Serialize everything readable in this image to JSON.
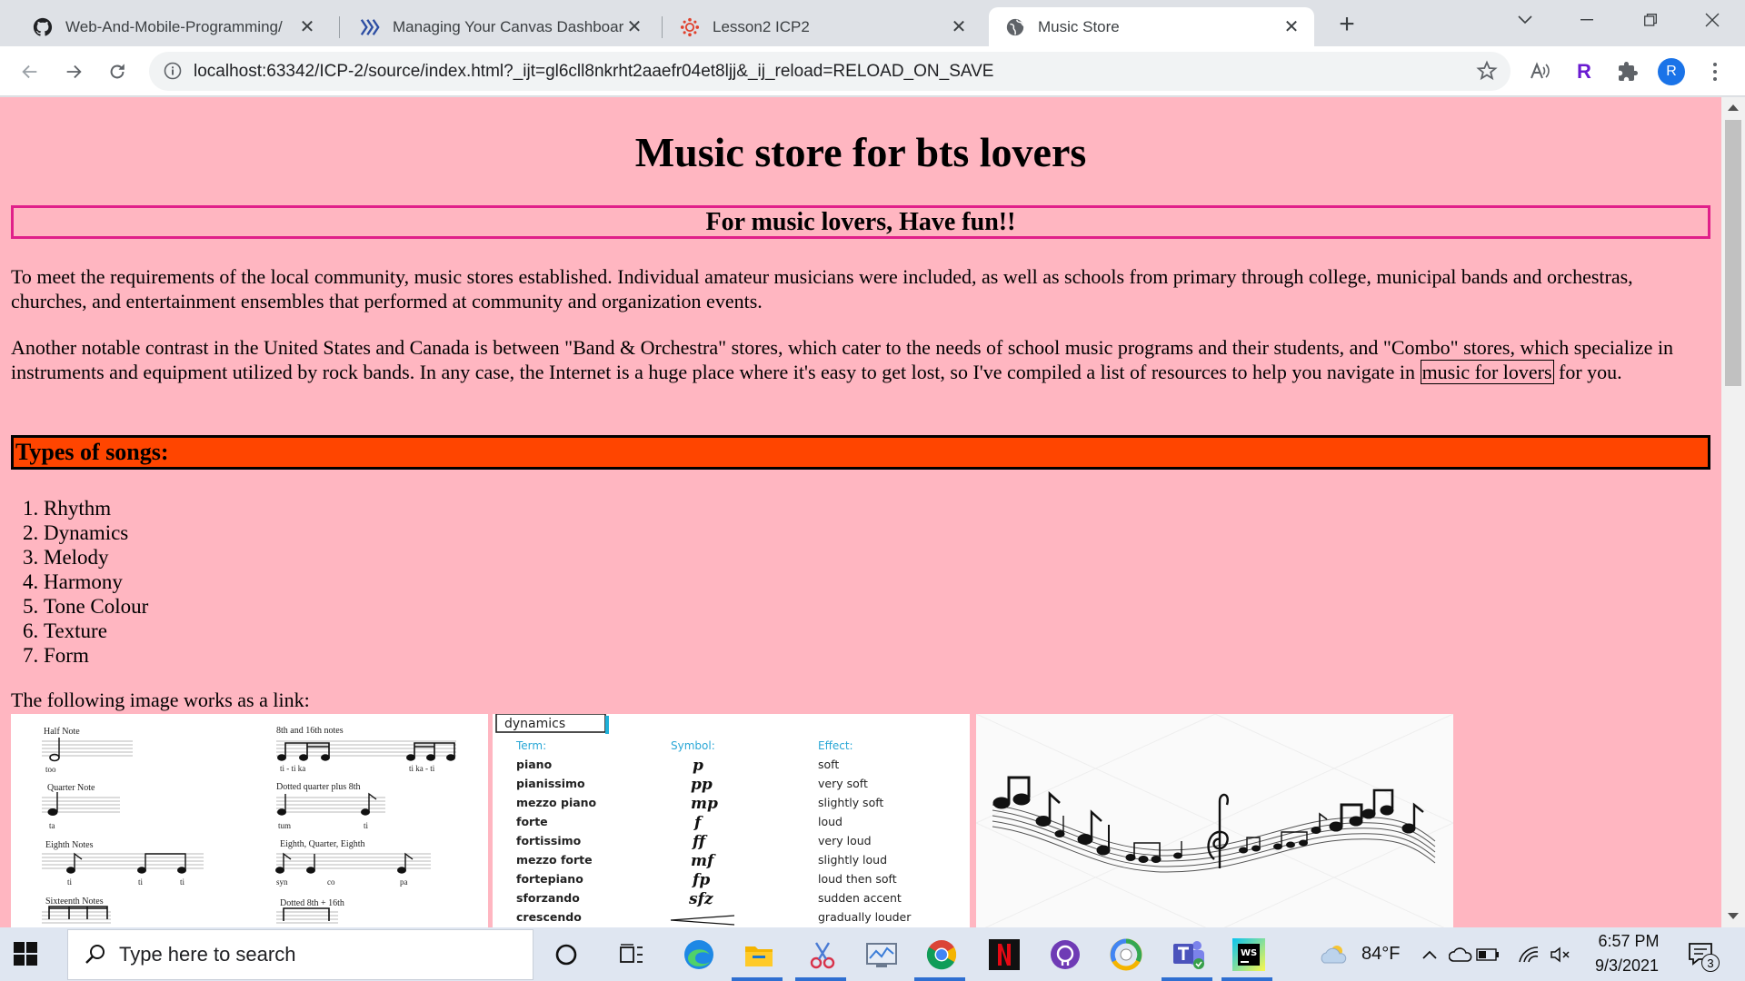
{
  "browser": {
    "tabs": [
      {
        "title": "Web-And-Mobile-Programming/",
        "favicon": "github-icon",
        "active": false
      },
      {
        "title": "Managing Your Canvas Dashboar",
        "favicon": "canvas-stripes-icon",
        "active": false
      },
      {
        "title": "Lesson2 ICP2",
        "favicon": "canvas-wheel-icon",
        "active": false
      },
      {
        "title": "Music Store",
        "favicon": "globe-icon",
        "active": true
      }
    ],
    "url": "localhost:63342/ICP-2/source/index.html?_ijt=gl6cll8nkrht2aaefr04et8ljj&_ij_reload=RELOAD_ON_SAVE",
    "profile_initial": "R",
    "extension_letter": "R"
  },
  "page": {
    "title": "Music store for bts lovers",
    "subtitle": "For music lovers, Have fun!!",
    "para1": "To meet the requirements of the local community, music stores established. Individual amateur musicians were included, as well as schools from primary through college, municipal bands and orchestras, churches, and entertainment ensembles that performed at community and organization events.",
    "para2_a": "Another notable contrast in the United States and Canada is between \"Band & Orchestra\" stores, which cater to the needs of school music programs and their students, and \"Combo\" stores, which specialize in instruments and equipment utilized by rock bands. In any case, the Internet is a huge place where it's easy to get lost, so I've compiled a list of resources to help you navigate in ",
    "para2_link": "music for lovers",
    "para2_b": " for you.",
    "types_heading": "Types of songs:",
    "songs": [
      "Rhythm",
      "Dynamics",
      "Melody",
      "Harmony",
      "Tone Colour",
      "Texture",
      "Form"
    ],
    "image_label": "The following image works as a link:",
    "notes_chart": {
      "labels": [
        "Half Note",
        "8th and 16th notes",
        "Quarter Note",
        "Dotted quarter plus 8th",
        "Eighth Notes",
        "Eighth, Quarter, Eighth",
        "Sixteenth Notes",
        "Dotted 8th + 16th"
      ],
      "syllables": [
        "too",
        "ti - ti ka",
        "ti ka - ti",
        "ta",
        "tum",
        "ti",
        "ti",
        "ti",
        "ti",
        "syn",
        "co",
        "pa"
      ]
    },
    "dynamics_chart": {
      "tab": "dynamics",
      "headers": [
        "Term:",
        "Symbol:",
        "Effect:"
      ],
      "rows": [
        {
          "term": "piano",
          "symbol": "p",
          "effect": "soft"
        },
        {
          "term": "pianissimo",
          "symbol": "pp",
          "effect": "very soft"
        },
        {
          "term": "mezzo piano",
          "symbol": "mp",
          "effect": "slightly soft"
        },
        {
          "term": "forte",
          "symbol": "f",
          "effect": "loud"
        },
        {
          "term": "fortissimo",
          "symbol": "ff",
          "effect": "very loud"
        },
        {
          "term": "mezzo forte",
          "symbol": "mf",
          "effect": "slightly loud"
        },
        {
          "term": "fortepiano",
          "symbol": "fp",
          "effect": "loud then soft"
        },
        {
          "term": "sforzando",
          "symbol": "sfz",
          "effect": "sudden accent"
        },
        {
          "term": "crescendo",
          "symbol": "",
          "effect": "gradually louder"
        }
      ]
    }
  },
  "taskbar": {
    "search_placeholder": "Type here to search",
    "weather": "84°F",
    "time": "6:57 PM",
    "date": "9/3/2021",
    "notification_count": "3"
  },
  "colors": {
    "page_bg": "#ffb6c1",
    "subtitle_border": "#e0208a",
    "types_bg": "#ff4500"
  }
}
